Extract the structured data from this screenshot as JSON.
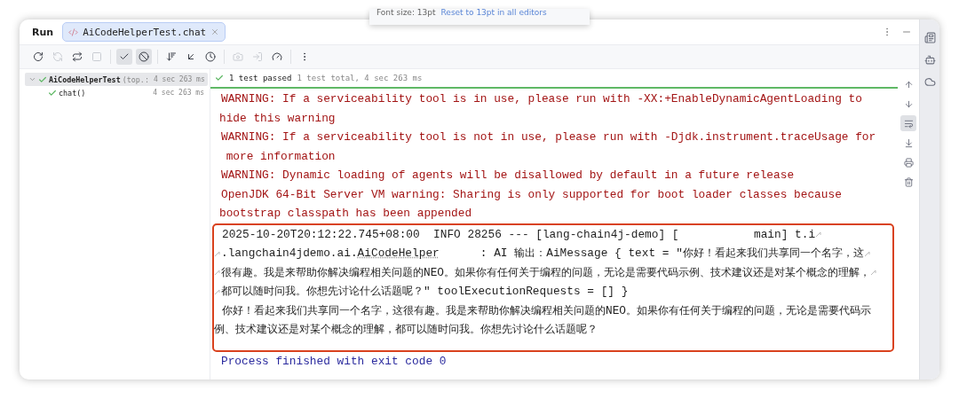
{
  "notification": {
    "text": "Font size: 13pt",
    "link": "Reset to 13pt in all editors"
  },
  "panel_title": "Run",
  "tabs": [
    {
      "label": "AiCodeHelperTest.chat",
      "selected": true
    }
  ],
  "toolbar": [
    {
      "disabled": false,
      "on": false
    },
    {
      "disabled": true,
      "on": false
    },
    {
      "disabled": false,
      "on": false
    },
    {
      "disabled": true,
      "on": false
    },
    {
      "disabled": false,
      "on": true
    },
    {
      "disabled": false,
      "on": true
    },
    {
      "disabled": false,
      "on": false
    },
    {
      "disabled": false,
      "on": false
    },
    {
      "disabled": false,
      "on": false
    },
    {
      "disabled": true,
      "on": false
    },
    {
      "disabled": true,
      "on": false
    },
    {
      "disabled": false,
      "on": false
    },
    {
      "disabled": false,
      "on": false
    }
  ],
  "tree": [
    {
      "name": "AiCodeHelperTest",
      "detail": "(top.:",
      "time": "4 sec 263 ms",
      "passed": true,
      "selected": true,
      "expanded": true,
      "children": [
        {
          "name": "chat()",
          "time": "4 sec 263 ms",
          "passed": true,
          "selected": false
        }
      ]
    }
  ],
  "status": {
    "result": "1 test passed",
    "summary": "1 test total, 4 sec 263 ms"
  },
  "console": [
    {
      "text": "WARNING: If a serviceability tool is in use, please run with -XX:+EnableDynamicAgentLoading to",
      "kind": "error",
      "continued": false,
      "wrapped": false,
      "highlighted": false
    },
    {
      "text": "hide this warning",
      "kind": "error",
      "continued": true,
      "wrapped": false,
      "highlighted": false
    },
    {
      "text": "WARNING: If a serviceability tool is not in use, please run with -Djdk.instrument.traceUsage for",
      "kind": "error",
      "continued": false,
      "wrapped": false,
      "highlighted": false
    },
    {
      "text": " more information",
      "kind": "error",
      "continued": true,
      "wrapped": false,
      "highlighted": false
    },
    {
      "text": "WARNING: Dynamic loading of agents will be disallowed by default in a future release",
      "kind": "error",
      "continued": false,
      "wrapped": false,
      "highlighted": false
    },
    {
      "text": "OpenJDK 64-Bit Server VM warning: Sharing is only supported for boot loader classes because",
      "kind": "error",
      "continued": false,
      "wrapped": false,
      "highlighted": false
    },
    {
      "text": "bootstrap classpath has been appended",
      "kind": "error",
      "continued": true,
      "wrapped": false,
      "highlighted": false
    },
    {
      "text": "2025-10-20T20:12:22.745+08:00  INFO 28256 --- [lang-chain4j-demo] [           main] t.i",
      "kind": "normal",
      "continued": false,
      "wrapped": true,
      "highlighted": true
    },
    {
      "text": ".langchain4jdemo.ai.",
      "link": "AiCodeHelper",
      "text_after": "      : AI 输出：AiMessage { text = \"你好！看起来我们共享同一个名字，这",
      "kind": "normal",
      "continued": true,
      "wrapped": true,
      "highlighted": true
    },
    {
      "text": "很有趣。我是来帮助你解决编程相关问题的NEO。如果你有任何关于编程的问题，无论是需要代码示例、技术建议还是对某个概念的理解，",
      "kind": "normal",
      "continued": true,
      "wrapped": true,
      "highlighted": true
    },
    {
      "text": "都可以随时问我。你想先讨论什么话题呢？\" toolExecutionRequests = [] }",
      "kind": "normal",
      "continued": true,
      "wrapped": false,
      "highlighted": true
    },
    {
      "text": "你好！看起来我们共享同一个名字，这很有趣。我是来帮助你解决编程相关问题的NEO。如果你有任何关于编程的问题，无论是需要代码示",
      "kind": "normal",
      "continued": false,
      "wrapped": false,
      "highlighted": true
    },
    {
      "text": "例、技术建议还是对某个概念的理解，都可以随时问我。你想先讨论什么话题呢？",
      "kind": "normal",
      "continued": true,
      "wrapped": false,
      "highlighted": true
    },
    {
      "text": "Process finished with exit code 0",
      "kind": "system",
      "continued": false,
      "wrapped": false,
      "highlighted": false
    }
  ],
  "console_toolbar": [
    {
      "on": false
    },
    {
      "on": false
    },
    {
      "on": true
    },
    {
      "on": false
    },
    {
      "on": false
    },
    {
      "on": false
    }
  ]
}
